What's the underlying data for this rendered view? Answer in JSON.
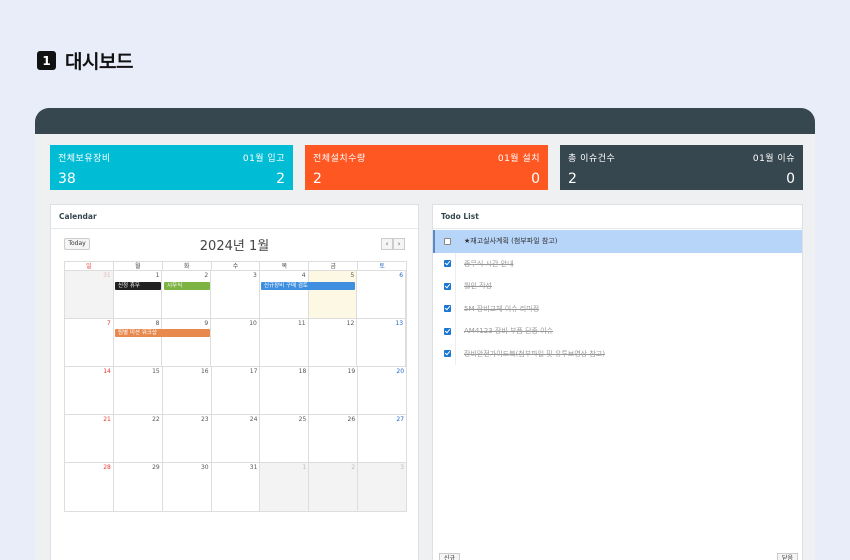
{
  "heading": {
    "step": "1",
    "title": "대시보드"
  },
  "stats": [
    {
      "label": "전체보유장비",
      "sub_label": "01월 입고",
      "value": "38",
      "sub_value": "2",
      "color": "#00bcd4"
    },
    {
      "label": "전체설치수량",
      "sub_label": "01월 설치",
      "value": "2",
      "sub_value": "0",
      "color": "#ff5722"
    },
    {
      "label": "총 이슈건수",
      "sub_label": "01월 이슈",
      "value": "2",
      "sub_value": "0",
      "color": "#37474f"
    }
  ],
  "calendar": {
    "panel_title": "Calendar",
    "today_label": "Today",
    "month_title": "2024년 1월",
    "prev": "‹",
    "next": "›",
    "weekdays": [
      "일",
      "월",
      "화",
      "수",
      "목",
      "금",
      "토"
    ],
    "weeks": [
      [
        "31",
        "1",
        "2",
        "3",
        "4",
        "5",
        "6"
      ],
      [
        "7",
        "8",
        "9",
        "10",
        "11",
        "12",
        "13"
      ],
      [
        "14",
        "15",
        "16",
        "17",
        "18",
        "19",
        "20"
      ],
      [
        "21",
        "22",
        "23",
        "24",
        "25",
        "26",
        "27"
      ],
      [
        "28",
        "29",
        "30",
        "31",
        "1",
        "2",
        "3"
      ]
    ],
    "events": [
      {
        "title": "신정 휴무",
        "color": "#212121"
      },
      {
        "title": "시무식",
        "color": "#7cb342"
      },
      {
        "title": "신규장비 구매 검토",
        "color": "#3f8fe0"
      },
      {
        "title": "팀별 미션 워크샵",
        "color": "#e8894e"
      }
    ]
  },
  "todo": {
    "panel_title": "Todo List",
    "items": [
      {
        "text": "★재고실사계획 (첨부파일 참고)",
        "done": false
      },
      {
        "text": "종무식 시간 안내",
        "done": true
      },
      {
        "text": "월인 작성",
        "done": true
      },
      {
        "text": "5M 장비교체 이슈 리마정",
        "done": true
      },
      {
        "text": "AM4123 장비 부품 단종 이슈",
        "done": true
      },
      {
        "text": "장비안전가이드북(첨부파일 및 유투브영상 참고)",
        "done": true
      }
    ],
    "footer_left": "신규",
    "footer_right": "닫음"
  }
}
